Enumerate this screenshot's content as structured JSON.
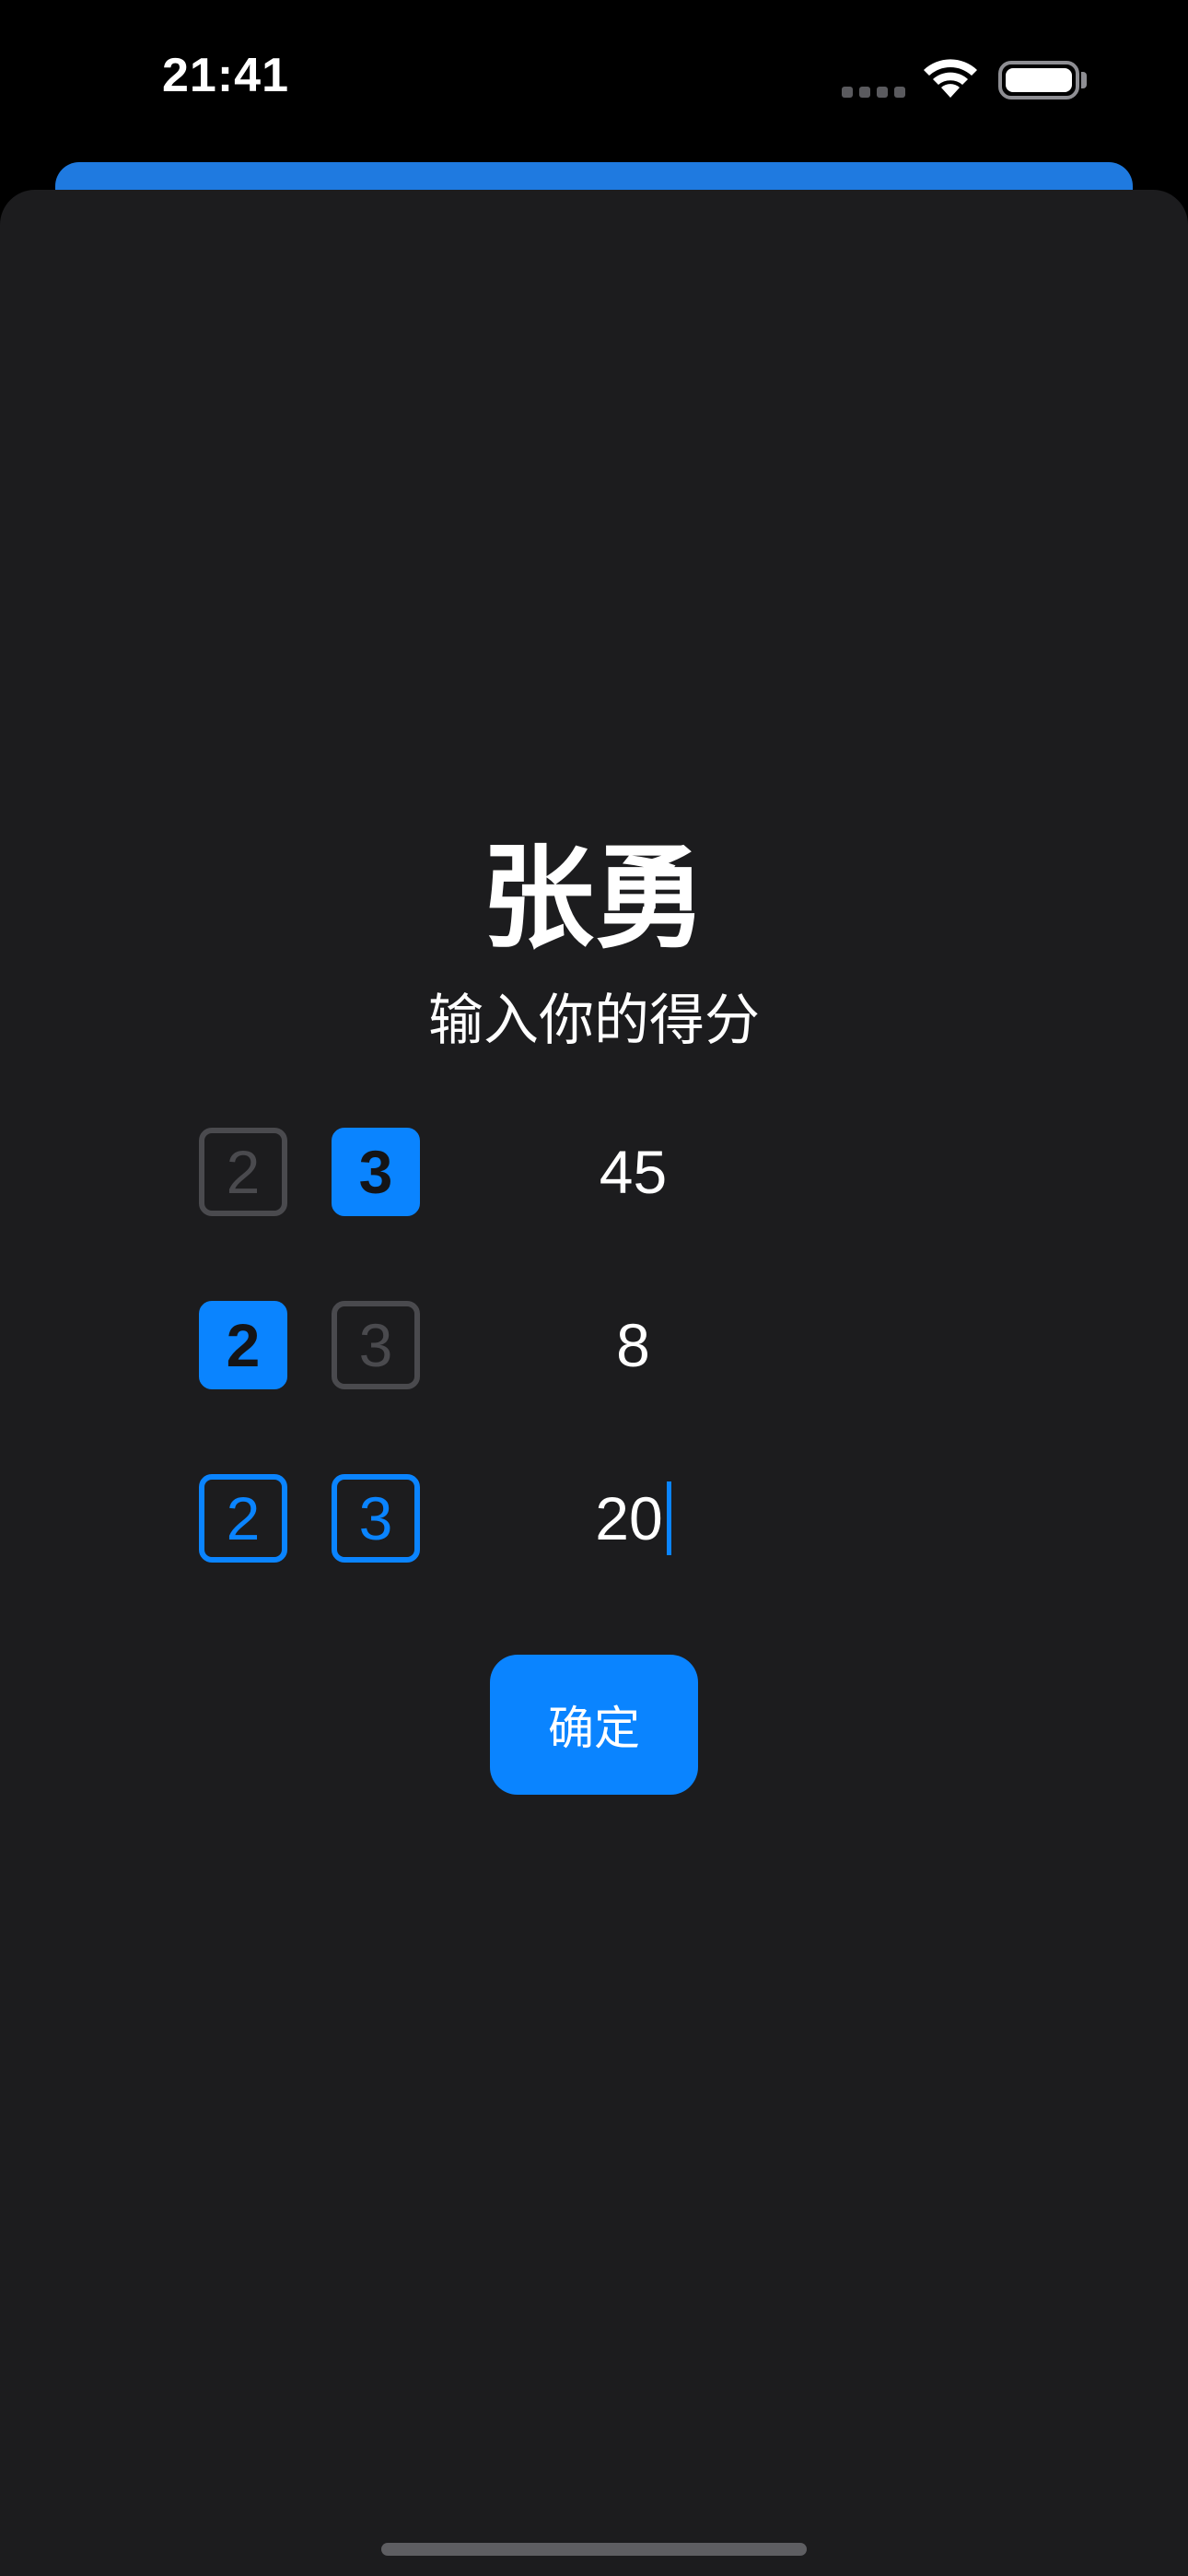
{
  "status_bar": {
    "time": "21:41",
    "icons": [
      "signal-dots-icon",
      "wifi-icon",
      "battery-icon"
    ]
  },
  "sheet": {
    "title": "张勇",
    "subtitle": "输入你的得分"
  },
  "score_rows": [
    {
      "options": [
        {
          "label": "2",
          "state": "unselected"
        },
        {
          "label": "3",
          "state": "selected"
        }
      ],
      "score": "45"
    },
    {
      "options": [
        {
          "label": "2",
          "state": "selected"
        },
        {
          "label": "3",
          "state": "unselected"
        }
      ],
      "score": "8"
    },
    {
      "options": [
        {
          "label": "2",
          "state": "active"
        },
        {
          "label": "3",
          "state": "active"
        }
      ],
      "score": "20",
      "focused": true
    }
  ],
  "confirm_button": {
    "label": "确定"
  },
  "colors": {
    "accent": "#0a84ff",
    "sheet_background": "#1c1c1e",
    "inactive_border": "#4a4a4e",
    "back_sheet": "#1f7ae0"
  }
}
